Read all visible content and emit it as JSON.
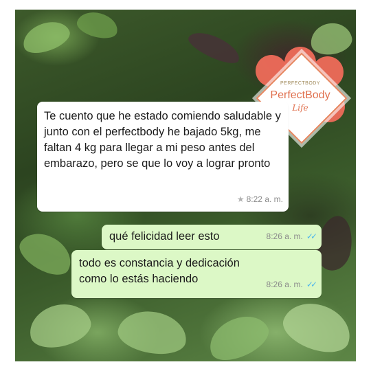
{
  "brand": {
    "small_text": "PERFECTBODY",
    "title": "PerfectBody",
    "subtitle": "Life",
    "accent_color": "#e0704e",
    "flower_color": "#ef6b5a"
  },
  "chat": {
    "messages": [
      {
        "direction": "incoming",
        "text": "Te cuento que he estado comiendo saludable y junto con el perfectbody he bajado 5kg, me faltan 4 kg para llegar a mi peso antes del embarazo, pero se que lo voy a lograr pronto",
        "time": "8:22 a. m.",
        "starred": true,
        "icon": "star-icon"
      },
      {
        "direction": "outgoing",
        "text": "qué felicidad leer esto",
        "time": "8:26 a. m.",
        "status": "read",
        "icon": "double-check-icon"
      },
      {
        "direction": "outgoing",
        "text": "todo es constancia y dedicación como lo estás haciendo",
        "time": "8:26 a. m.",
        "status": "read",
        "icon": "double-check-icon"
      }
    ],
    "colors": {
      "incoming_bubble": "#ffffff",
      "outgoing_bubble": "#dcf8c6",
      "read_ticks": "#4fb6ec"
    }
  }
}
